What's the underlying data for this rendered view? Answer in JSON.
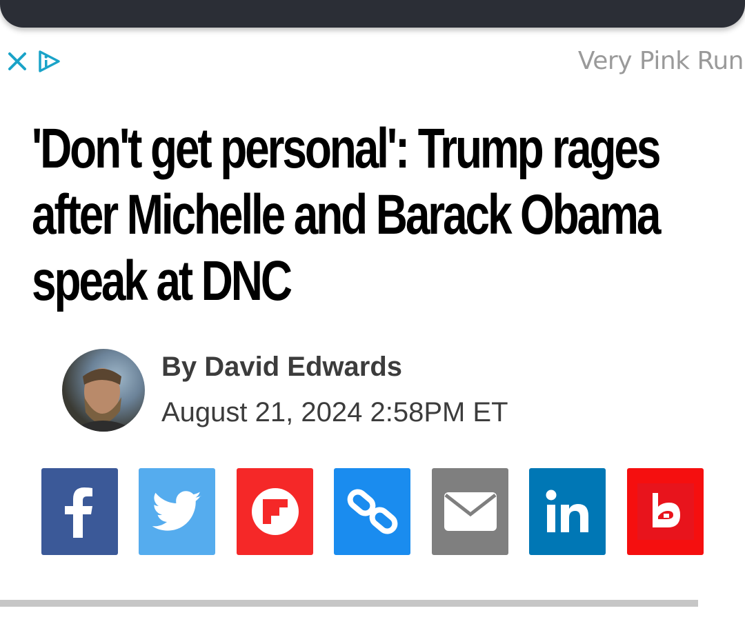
{
  "ad": {
    "close_icon": "close-x-icon",
    "adchoices_icon": "adchoices-icon",
    "text": "Very Pink Run",
    "accent_color": "#1aa3c8"
  },
  "article": {
    "headline": "'Don't get personal': Trump rages after Michelle and Barack Obama speak at DNC",
    "author": "By David Edwards",
    "date": "August 21, 2024 2:58PM ET"
  },
  "share_buttons": [
    {
      "name": "facebook",
      "icon": "facebook-icon",
      "color": "#3b5998"
    },
    {
      "name": "twitter",
      "icon": "twitter-bird-icon",
      "color": "#55acee"
    },
    {
      "name": "flipboard",
      "icon": "flipboard-icon",
      "color": "#f52828"
    },
    {
      "name": "copy-link",
      "icon": "link-chain-icon",
      "color": "#1a8cef"
    },
    {
      "name": "email",
      "icon": "envelope-icon",
      "color": "#7f7f7f"
    },
    {
      "name": "linkedin",
      "icon": "linkedin-icon",
      "color": "#0077b5"
    },
    {
      "name": "other",
      "icon": "share-brand-icon",
      "color": "#f50f0f"
    }
  ]
}
